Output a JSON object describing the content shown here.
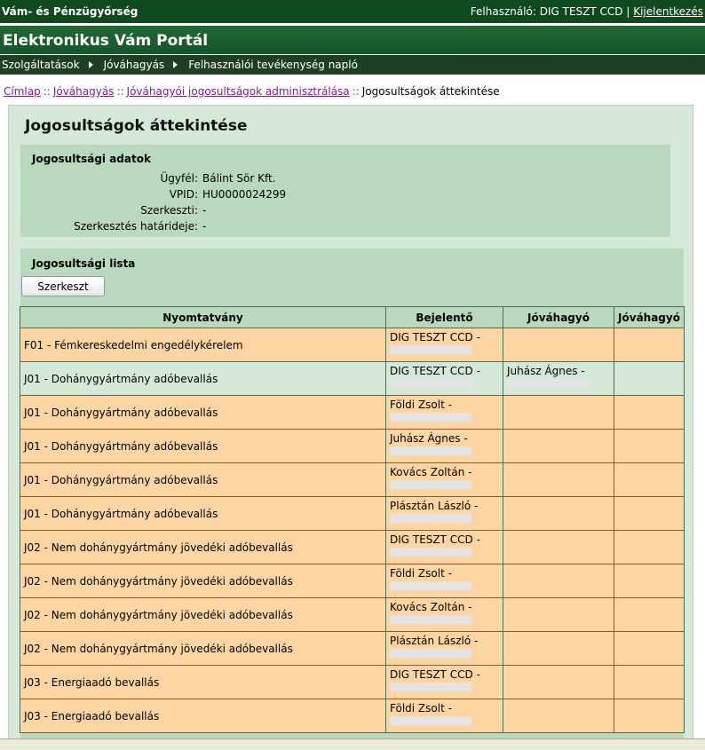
{
  "topbar": {
    "org_name": "Vám- és Pénzügyőrség",
    "user_label": "Felhasználó: DIG TESZT CCD |",
    "logout": "Kijelentkezés"
  },
  "banner": {
    "title": "Elektronikus Vám Portál"
  },
  "nav": [
    {
      "label": "Szolgáltatások"
    },
    {
      "label": "Jóváhagyás"
    },
    {
      "label": "Felhasználói tevékenység napló"
    }
  ],
  "breadcrumb": {
    "items": [
      "Címlap",
      "Jóváhagyás",
      "Jóváhagyói jogosultságok adminisztrálása"
    ],
    "separator": "::",
    "current": "Jogosultságok áttekintése"
  },
  "page_title": "Jogosultságok áttekintése",
  "info": {
    "heading": "Jogosultsági adatok",
    "rows": [
      {
        "label": "Ügyfél:",
        "value": "Bálint Sör Kft."
      },
      {
        "label": "VPID:",
        "value": "HU0000024299"
      },
      {
        "label": "Szerkeszti:",
        "value": "-"
      },
      {
        "label": "Szerkesztés határideje:",
        "value": "-"
      }
    ]
  },
  "list": {
    "heading": "Jogosultsági lista",
    "edit_button": "Szerkeszt",
    "columns": [
      "Nyomtatvány",
      "Bejelentő",
      "Jóváhagyó",
      "Jóváhagyó"
    ],
    "rows": [
      {
        "form": "F01 - Fémkereskedelmi engedélykérelem",
        "reporter": "DIG TESZT CCD -",
        "approver": "",
        "highlight": "orange"
      },
      {
        "form": "J01 - Dohánygyártmány adóbevallás",
        "reporter": "DIG TESZT CCD -",
        "approver": "Juhász Ágnes -",
        "highlight": "green"
      },
      {
        "form": "J01 - Dohánygyártmány adóbevallás",
        "reporter": "Földi Zsolt -",
        "approver": "",
        "highlight": "orange"
      },
      {
        "form": "J01 - Dohánygyártmány adóbevallás",
        "reporter": "Juhász Ágnes -",
        "approver": "",
        "highlight": "orange"
      },
      {
        "form": "J01 - Dohánygyártmány adóbevallás",
        "reporter": "Kovács Zoltán -",
        "approver": "",
        "highlight": "orange"
      },
      {
        "form": "J01 - Dohánygyártmány adóbevallás",
        "reporter": "Plásztán László -",
        "approver": "",
        "highlight": "orange"
      },
      {
        "form": "J02 - Nem dohánygyártmány jövedéki adóbevallás",
        "reporter": "DIG TESZT CCD -",
        "approver": "",
        "highlight": "orange"
      },
      {
        "form": "J02 - Nem dohánygyártmány jövedéki adóbevallás",
        "reporter": "Földi Zsolt -",
        "approver": "",
        "highlight": "orange"
      },
      {
        "form": "J02 - Nem dohánygyártmány jövedéki adóbevallás",
        "reporter": "Kovács Zoltán -",
        "approver": "",
        "highlight": "orange"
      },
      {
        "form": "J02 - Nem dohánygyártmány jövedéki adóbevallás",
        "reporter": "Plásztán László -",
        "approver": "",
        "highlight": "orange"
      },
      {
        "form": "J03 - Energiaadó bevallás",
        "reporter": "DIG TESZT CCD -",
        "approver": "",
        "highlight": "orange"
      },
      {
        "form": "J03 - Energiaadó bevallás",
        "reporter": "Földi Zsolt -",
        "approver": "",
        "highlight": "orange"
      }
    ]
  }
}
